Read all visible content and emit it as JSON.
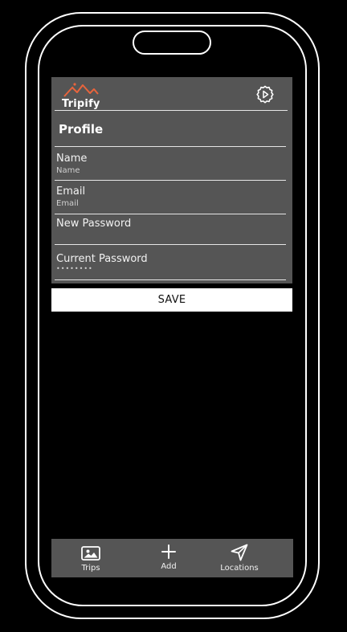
{
  "app": {
    "logo_text": "Tripify"
  },
  "profile": {
    "title": "Profile",
    "fields": [
      {
        "label": "Name",
        "placeholder": "Name"
      },
      {
        "label": "Email",
        "placeholder": "Email"
      },
      {
        "label": "New Password",
        "placeholder": ""
      },
      {
        "label": "Current Password",
        "placeholder": "••••••••"
      }
    ],
    "save_label": "SAVE"
  },
  "tabbar": {
    "items": [
      {
        "label": "Trips",
        "icon": "image-icon"
      },
      {
        "label": "Add",
        "icon": "plus-icon"
      },
      {
        "label": "Locations",
        "icon": "navigation-arrow-icon"
      }
    ]
  },
  "colors": {
    "background": "#000000",
    "panel": "#555555",
    "accent": "#E8643C",
    "button_bg": "#FFFFFF"
  }
}
